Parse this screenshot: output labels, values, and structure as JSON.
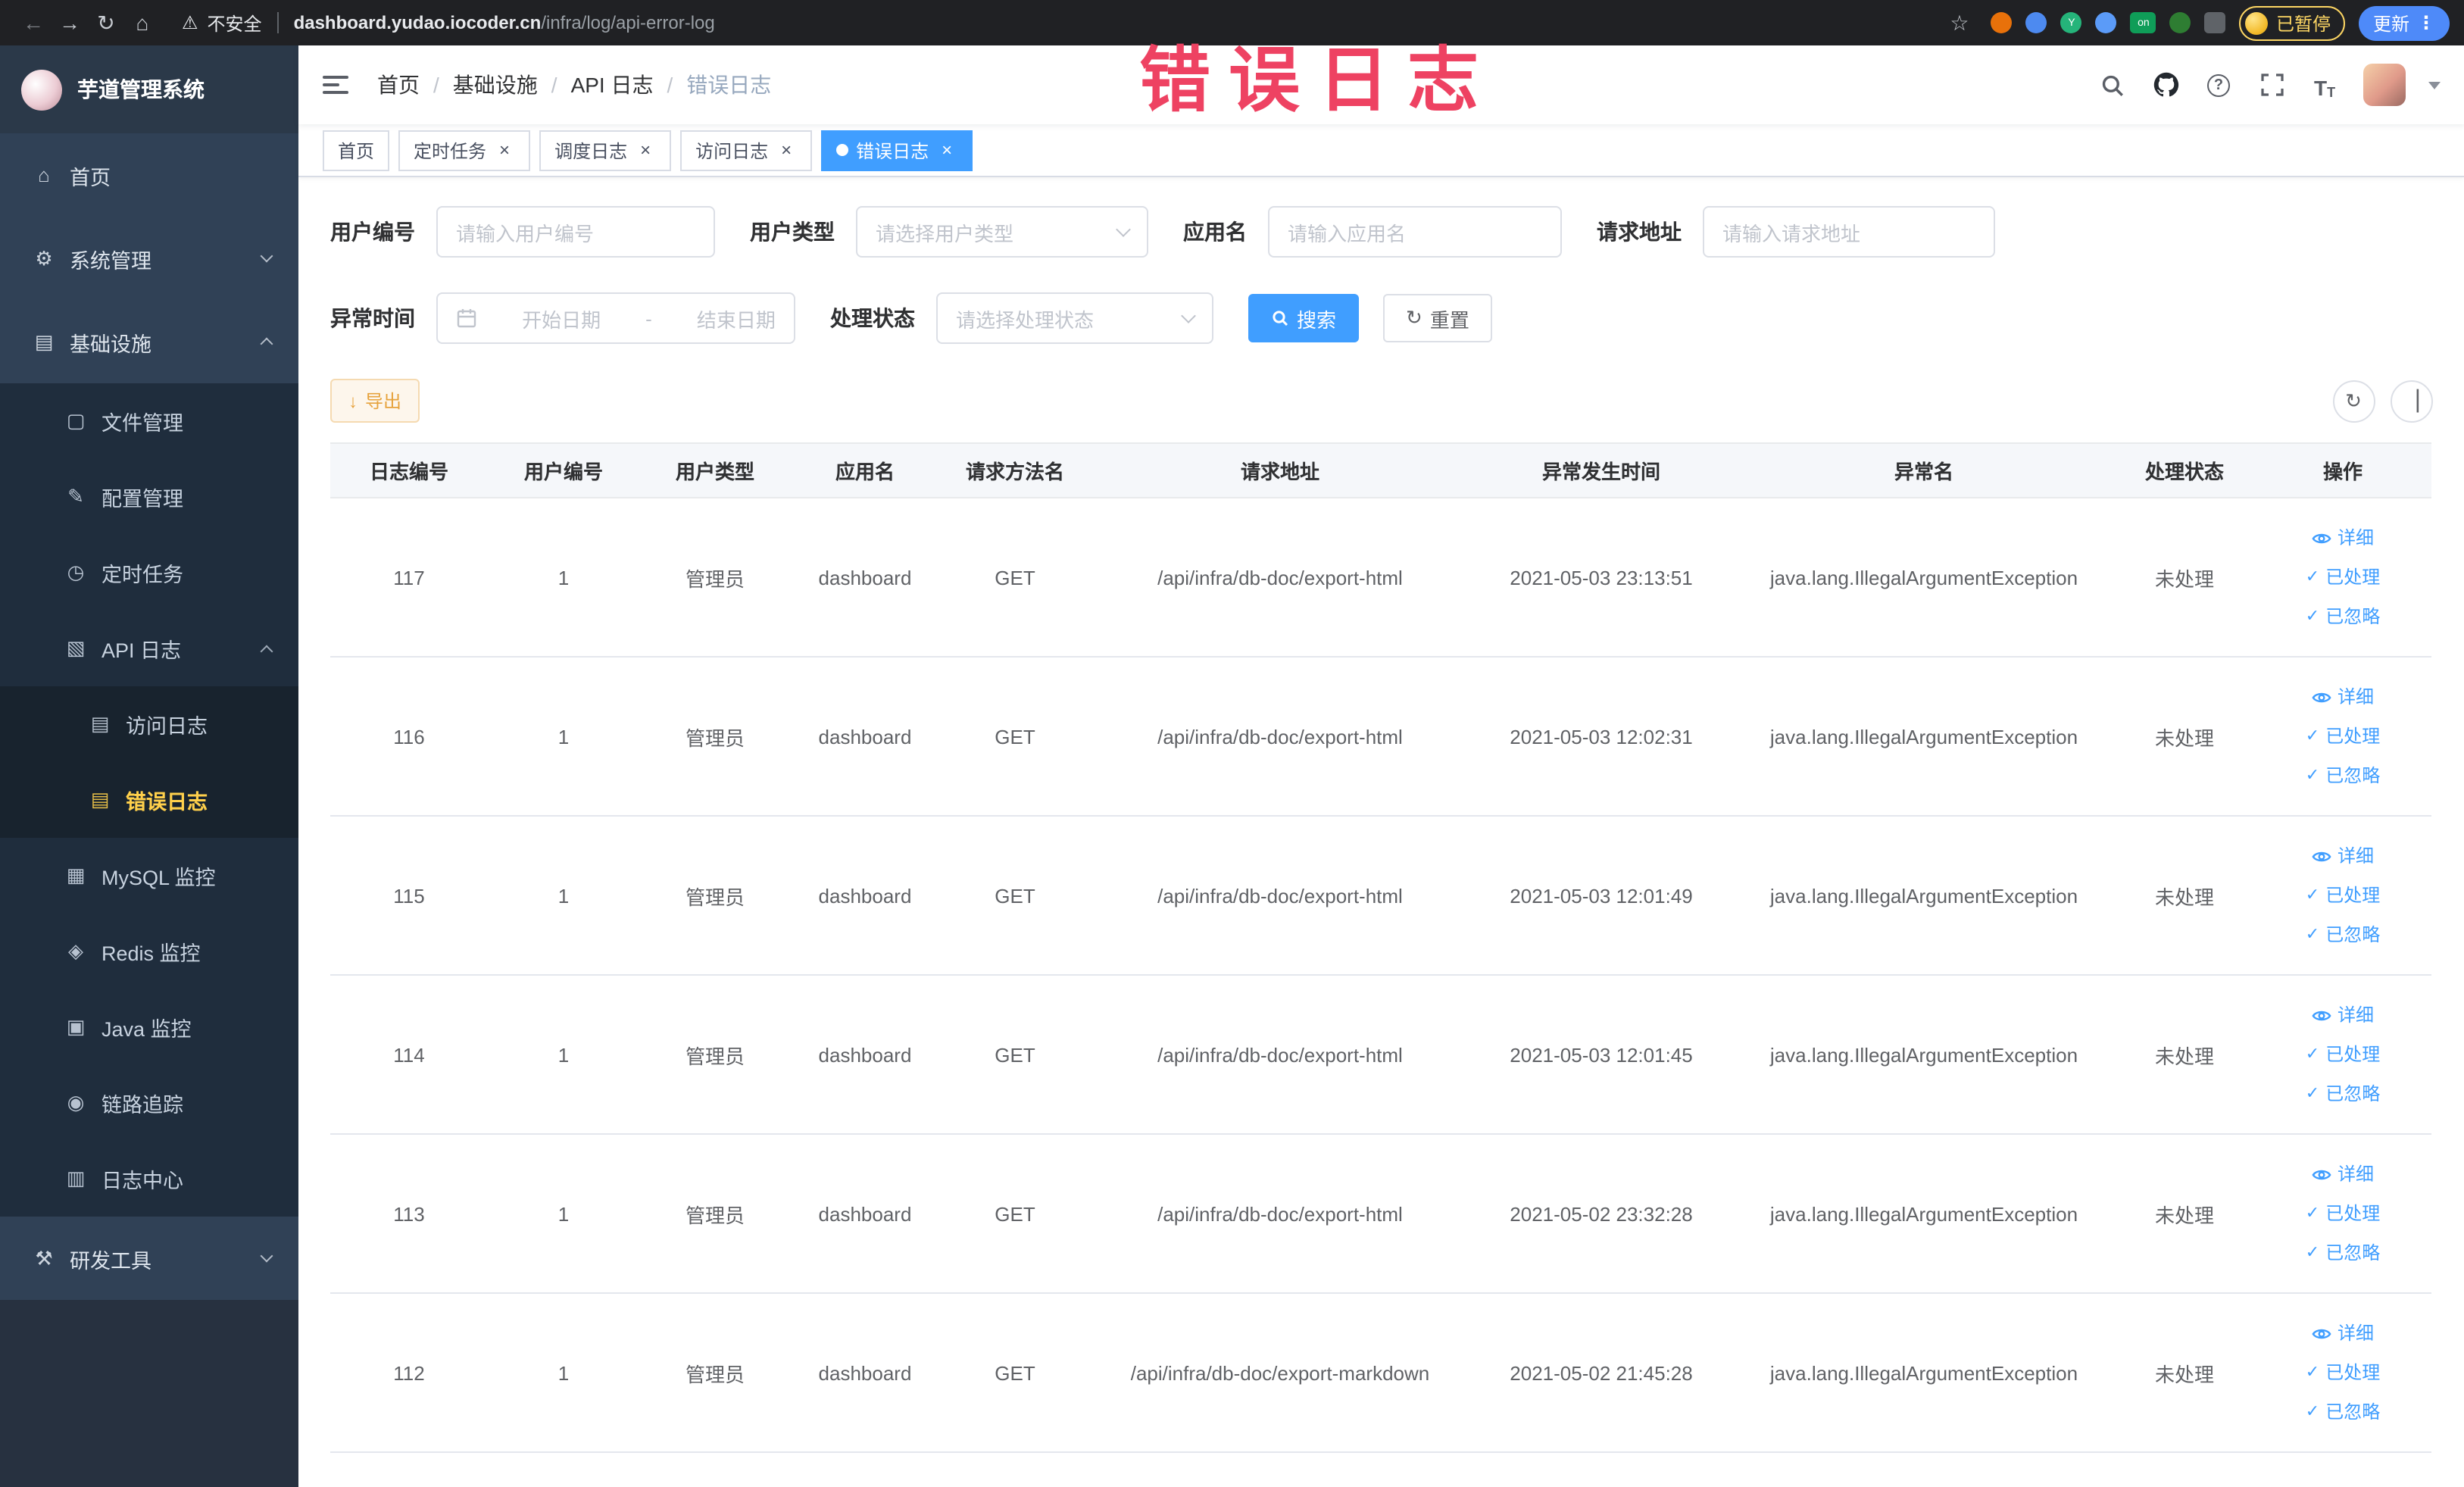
{
  "browser": {
    "security_label": "不安全",
    "url_domain": "dashboard.yudao.iocoder.cn",
    "url_path": "/infra/log/api-error-log",
    "profile_badge": "已暂停",
    "update_button": "更新"
  },
  "annotation": {
    "text": "错误日志",
    "color": "#ee4262"
  },
  "sidebar": {
    "title": "芋道管理系统",
    "items": [
      {
        "label": "首页",
        "icon": "home-icon",
        "level": 0
      },
      {
        "label": "系统管理",
        "icon": "gear-icon",
        "level": 0,
        "arrow": "down"
      },
      {
        "label": "基础设施",
        "icon": "infrastructure-icon",
        "level": 0,
        "arrow": "up"
      },
      {
        "label": "文件管理",
        "icon": "file-icon",
        "level": 1
      },
      {
        "label": "配置管理",
        "icon": "config-icon",
        "level": 1
      },
      {
        "label": "定时任务",
        "icon": "schedule-icon",
        "level": 1
      },
      {
        "label": "API 日志",
        "icon": "api-log-icon",
        "level": 1,
        "arrow": "up"
      },
      {
        "label": "访问日志",
        "icon": "access-log-icon",
        "level": 2
      },
      {
        "label": "错误日志",
        "icon": "error-log-icon",
        "level": 2,
        "active": true
      },
      {
        "label": "MySQL 监控",
        "icon": "mysql-icon",
        "level": 1
      },
      {
        "label": "Redis 监控",
        "icon": "redis-icon",
        "level": 1
      },
      {
        "label": "Java 监控",
        "icon": "java-icon",
        "level": 1
      },
      {
        "label": "链路追踪",
        "icon": "trace-icon",
        "level": 1
      },
      {
        "label": "日志中心",
        "icon": "log-center-icon",
        "level": 1
      },
      {
        "label": "研发工具",
        "icon": "devtools-icon",
        "level": 0,
        "arrow": "down"
      }
    ]
  },
  "header": {
    "breadcrumb": [
      "首页",
      "基础设施",
      "API 日志",
      "错误日志"
    ]
  },
  "tabs": [
    {
      "label": "首页",
      "closable": false,
      "active": false
    },
    {
      "label": "定时任务",
      "closable": true,
      "active": false
    },
    {
      "label": "调度日志",
      "closable": true,
      "active": false
    },
    {
      "label": "访问日志",
      "closable": true,
      "active": false
    },
    {
      "label": "错误日志",
      "closable": true,
      "active": true
    }
  ],
  "filters": {
    "user_id": {
      "label": "用户编号",
      "placeholder": "请输入用户编号"
    },
    "user_type": {
      "label": "用户类型",
      "placeholder": "请选择用户类型"
    },
    "app_name": {
      "label": "应用名",
      "placeholder": "请输入应用名"
    },
    "request_url": {
      "label": "请求地址",
      "placeholder": "请输入请求地址"
    },
    "exception_time": {
      "label": "异常时间",
      "start_placeholder": "开始日期",
      "separator": "-",
      "end_placeholder": "结束日期"
    },
    "process_status": {
      "label": "处理状态",
      "placeholder": "请选择处理状态"
    },
    "search_label": "搜索",
    "reset_label": "重置"
  },
  "toolbar": {
    "export_label": "导出"
  },
  "table": {
    "columns": [
      "日志编号",
      "用户编号",
      "用户类型",
      "应用名",
      "请求方法名",
      "请求地址",
      "异常发生时间",
      "异常名",
      "处理状态",
      "操作"
    ],
    "rows": [
      {
        "id": "117",
        "user_id": "1",
        "user_type": "管理员",
        "app_name": "dashboard",
        "method": "GET",
        "url": "/api/infra/db-doc/export-html",
        "time": "2021-05-03 23:13:51",
        "exception": "java.lang.IllegalArgumentException",
        "status": "未处理"
      },
      {
        "id": "116",
        "user_id": "1",
        "user_type": "管理员",
        "app_name": "dashboard",
        "method": "GET",
        "url": "/api/infra/db-doc/export-html",
        "time": "2021-05-03 12:02:31",
        "exception": "java.lang.IllegalArgumentException",
        "status": "未处理"
      },
      {
        "id": "115",
        "user_id": "1",
        "user_type": "管理员",
        "app_name": "dashboard",
        "method": "GET",
        "url": "/api/infra/db-doc/export-html",
        "time": "2021-05-03 12:01:49",
        "exception": "java.lang.IllegalArgumentException",
        "status": "未处理"
      },
      {
        "id": "114",
        "user_id": "1",
        "user_type": "管理员",
        "app_name": "dashboard",
        "method": "GET",
        "url": "/api/infra/db-doc/export-html",
        "time": "2021-05-03 12:01:45",
        "exception": "java.lang.IllegalArgumentException",
        "status": "未处理"
      },
      {
        "id": "113",
        "user_id": "1",
        "user_type": "管理员",
        "app_name": "dashboard",
        "method": "GET",
        "url": "/api/infra/db-doc/export-html",
        "time": "2021-05-02 23:32:28",
        "exception": "java.lang.IllegalArgumentException",
        "status": "未处理"
      },
      {
        "id": "112",
        "user_id": "1",
        "user_type": "管理员",
        "app_name": "dashboard",
        "method": "GET",
        "url": "/api/infra/db-doc/export-markdown",
        "time": "2021-05-02 21:45:28",
        "exception": "java.lang.IllegalArgumentException",
        "status": "未处理"
      }
    ],
    "actions": [
      "详细",
      "已处理",
      "已忽略"
    ]
  },
  "colors": {
    "primary": "#409eff",
    "sidebar_bg": "#304156",
    "submenu_bg": "#1f2d3d",
    "active_menu_text": "#ffd04b",
    "warning": "#e6a23c"
  }
}
